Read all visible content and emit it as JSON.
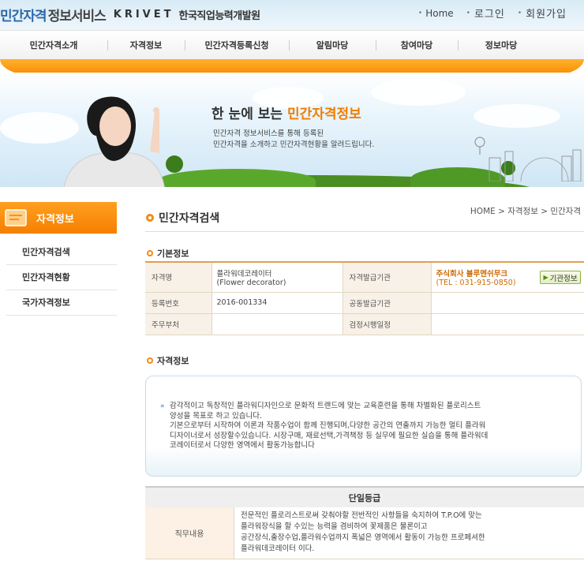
{
  "header": {
    "logo": {
      "part1": "민간자격",
      "part2": "정보서비스",
      "part3": "KRIVET",
      "part4": "한국직업능력개발원"
    },
    "links": {
      "home": "Home",
      "login": "로그인",
      "join": "회원가입"
    }
  },
  "gnb": {
    "items": [
      "민간자격소개",
      "자격정보",
      "민간자격등록신청",
      "알림마당",
      "참여마당",
      "정보마당"
    ]
  },
  "banner": {
    "title_a": "한 눈에 보는 ",
    "title_b": "민간자격정보",
    "desc_line1": "민간자격 정보서비스를 통해 등록된",
    "desc_line2": "민간자격을 소개하고 민간자격현황을 알려드립니다."
  },
  "sidebar": {
    "title": "자격정보",
    "items": [
      "민간자격검색",
      "민간자격현황",
      "국가자격정보"
    ]
  },
  "content": {
    "title": "민간자격검색",
    "breadcrumb": "HOME > 자격정보 > 민간자격",
    "basic_info": {
      "section_title": "기본정보",
      "rows": {
        "name_label": "자격명",
        "name_value_line1": "플라워데코레이터",
        "name_value_line2": "(Flower decorator)",
        "issuer_label": "자격발급기관",
        "issuer_value": "주식회사 블루멘쉬무크",
        "issuer_tel": "(TEL : 031-915-0850)",
        "issuer_button": "기관정보",
        "regno_label": "등록번호",
        "regno_value": "2016-001334",
        "coissuer_label": "공동발급기관",
        "coissuer_value": "",
        "ministry_label": "주무부처",
        "ministry_value": "",
        "exam_label": "검정시행일정",
        "exam_value": ""
      }
    },
    "qual_info": {
      "section_title": "자격정보",
      "desc_lines": [
        "감각적이고 독창적인 플라워디자인으로 문화적 트랜드에 맞는 교육훈련을 통해 차별화된 플로리스트",
        "양성을 목표로 하고 있습니다.",
        "기본으로부터 시작하여 이론과 작품수업이 함께 진행되며,다양한 공간의 연출까지 가능한 멀티 플라워",
        "디자이너로서 성장할수있습니다. 시장구매, 재료선택,가격책정 등 실무에 필요한 실습을 통해 플라워데",
        "코레이터로서 다양한 영역에서 활동가능합니다"
      ]
    },
    "grade": {
      "header": "단일등급",
      "duty_label": "직무내용",
      "duty_lines": [
        "전문적인 플로리스트로써 갖춰야할 전반적인 사항들을 숙지하여 T.P.O에 맞는",
        "플라워장식을 할 수있는 능력을 겸비하여 꽃제품은 물론이고",
        "공간장식,출장수업,플라워수업까지 폭넓은 영역에서 활동이 가능한 프로페셔한",
        "플라워데코레이터 이다."
      ]
    }
  },
  "colors": {
    "accent_orange": "#f78a00",
    "brand_blue": "#2d68a8",
    "org_text": "#d06a00"
  }
}
